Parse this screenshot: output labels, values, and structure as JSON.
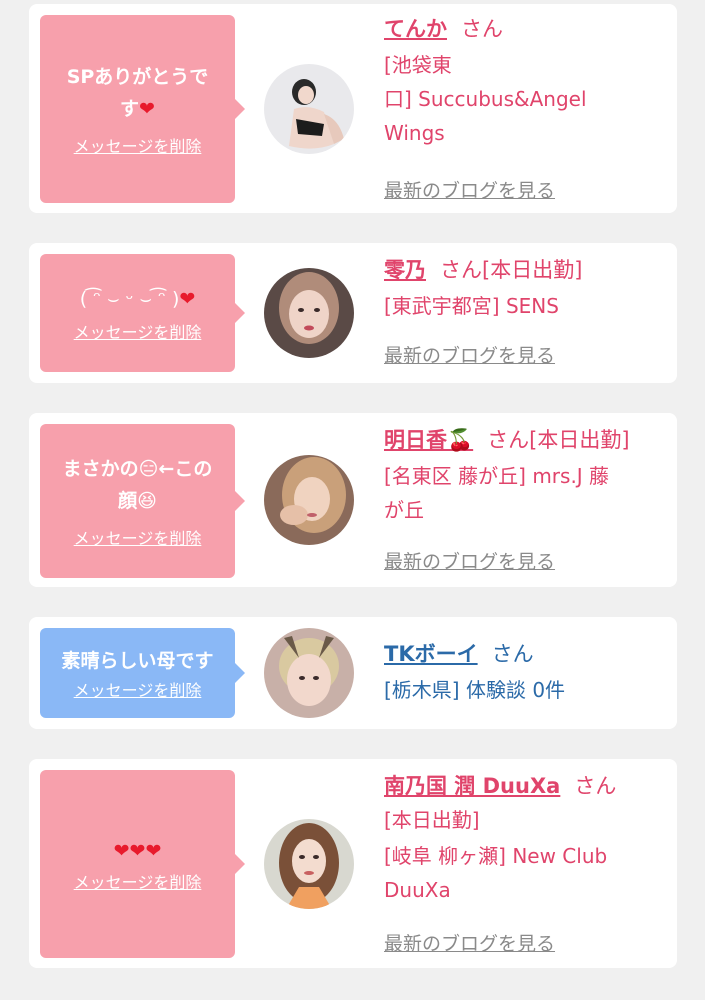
{
  "cards": [
    {
      "message": "SPありがとうです❤️",
      "delete_label": "メッセージを削除",
      "name": "てんか",
      "suffix": "さん",
      "location": "[池袋東口] Succubus&Angel Wings",
      "blog_label": "最新のブログを見る",
      "theme": "pink"
    },
    {
      "message": "( ͡ᵔ ⌣ ᵕ ⌣ ͡ᵔ )❤️",
      "delete_label": "メッセージを削除",
      "name": "零乃",
      "suffix": "さん[本日出勤]",
      "location": "[東武宇都宮] SENS",
      "blog_label": "最新のブログを見る",
      "theme": "pink"
    },
    {
      "message": "まさかの😑←この顔😆",
      "delete_label": "メッセージを削除",
      "name": "明日香🍒",
      "suffix": "さん[本日出勤]",
      "location": "[名東区 藤が丘] mrs.J 藤が丘",
      "blog_label": "最新のブログを見る",
      "theme": "pink"
    },
    {
      "message": "素晴らしい母です",
      "delete_label": "メッセージを削除",
      "name": "TKボーイ",
      "suffix": "さん",
      "location": "[栃木県] 体験談 0件",
      "theme": "blue"
    },
    {
      "message": "❤️❤️❤️",
      "delete_label": "メッセージを削除",
      "name": "南乃国 潤 DuuXa",
      "suffix": "さん",
      "status": "[本日出勤]",
      "location": "[岐阜 柳ヶ瀬] New Club DuuXa",
      "blog_label": "最新のブログを見る",
      "theme": "pink"
    }
  ],
  "colors": {
    "pink_bubble": "#f7a0ac",
    "blue_bubble": "#8ab8f6",
    "pink_text": "#e0446b",
    "blue_text": "#2b6aa8",
    "background": "#f0f0f0"
  }
}
